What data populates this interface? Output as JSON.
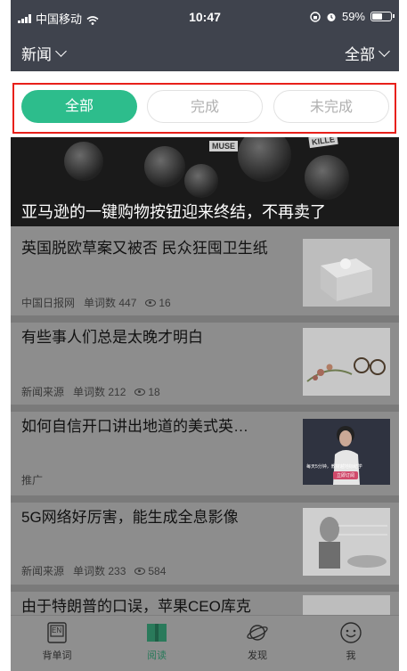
{
  "status": {
    "carrier": "中国移动",
    "time": "10:47",
    "battery": "59%",
    "battery_level": 0.59
  },
  "nav": {
    "left_label": "新闻",
    "right_label": "全部"
  },
  "filter": {
    "tabs": [
      {
        "label": "全部"
      },
      {
        "label": "完成"
      },
      {
        "label": "未完成"
      }
    ],
    "selected": "全部"
  },
  "hero": {
    "title": "亚马逊的一键购物按钮迎来终结，不再卖了",
    "tags": [
      "MUSE",
      "KILLE"
    ]
  },
  "articles": [
    {
      "title": "英国脱欧草案又被否 民众狂囤卫生纸",
      "source": "中国日报网",
      "words": "单词数 447",
      "views": "16"
    },
    {
      "title": "有些事人们总是太晚才明白",
      "source": "新闻来源",
      "words": "单词数 212",
      "views": "18"
    },
    {
      "title": "如何自信开口讲出地道的美式英…",
      "source": "推广",
      "ad_caption": "每天5分钟，教材越地标纪学",
      "ad_button": "立即订阅"
    },
    {
      "title": "5G网络好厉害，能生成全息影像",
      "source": "新闻来源",
      "words": "单词数 233",
      "views": "584"
    },
    {
      "title": "由于特朗普的口误，苹果CEO库克"
    }
  ],
  "tabs": [
    {
      "label": "背单词",
      "icon": "en-book-icon",
      "badge": "EN"
    },
    {
      "label": "阅读",
      "icon": "open-book-icon"
    },
    {
      "label": "发现",
      "icon": "planet-icon"
    },
    {
      "label": "我",
      "icon": "smiley-icon"
    }
  ],
  "colors": {
    "accent": "#2dbd8c",
    "highlight_box": "#e8201a",
    "nav_bg": "#3f434d"
  }
}
